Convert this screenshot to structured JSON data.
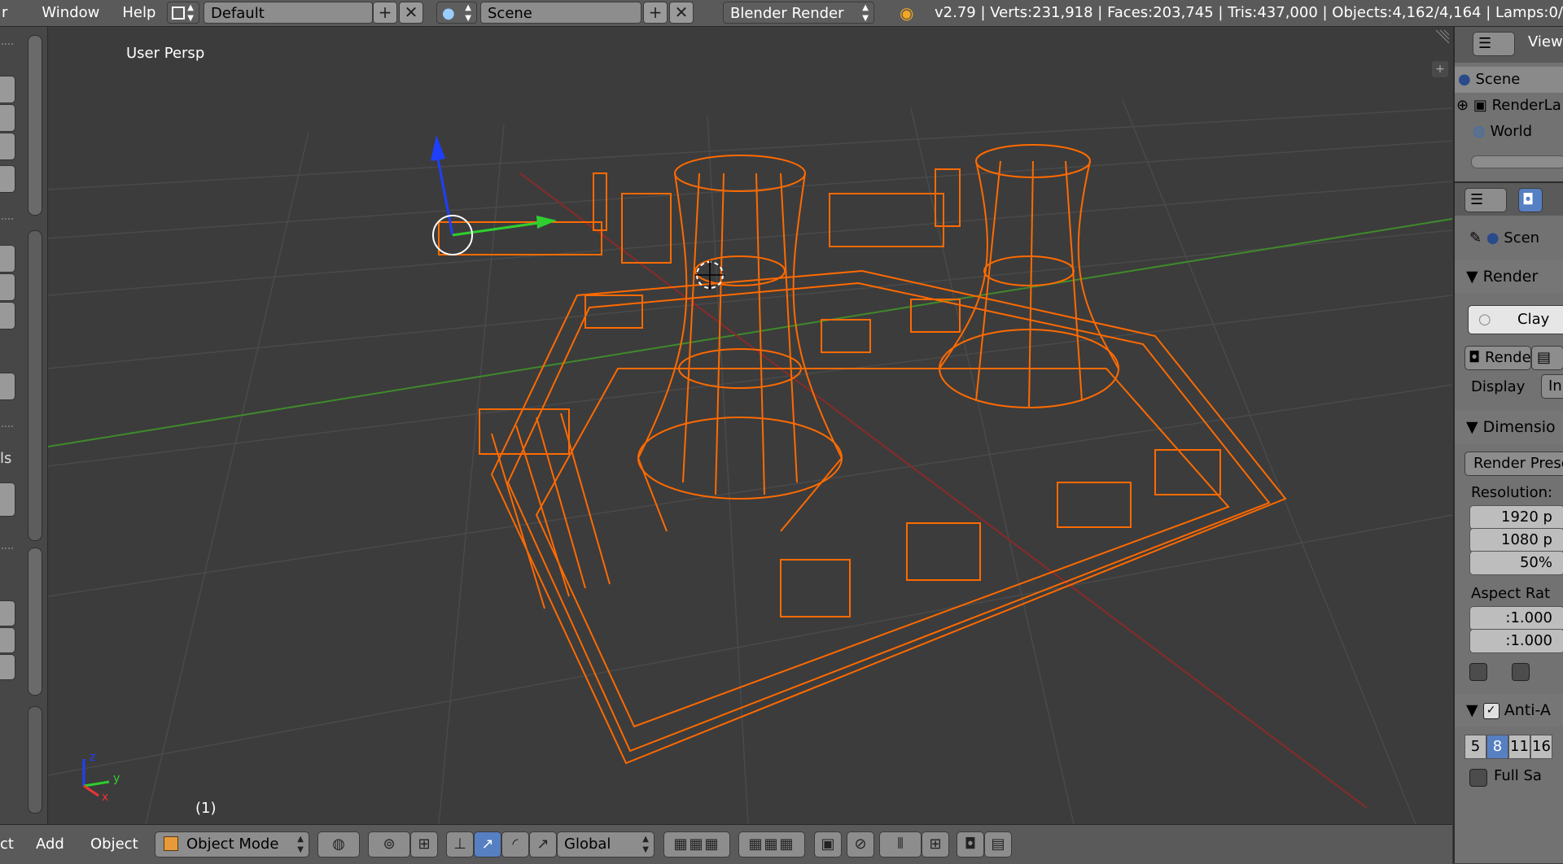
{
  "topbar": {
    "menus": [
      "r",
      "Window",
      "Help"
    ],
    "layout": "Default",
    "scene": "Scene",
    "engine": "Blender Render",
    "stats": "v2.79 | Verts:231,918 | Faces:203,745 | Tris:437,000 | Objects:4,162/4,164 | Lamps:0/1"
  },
  "left_strip": {
    "partial_label": "ls"
  },
  "viewport": {
    "view_label": "User Persp",
    "frame_label": "(1)",
    "axis_labels": {
      "x": "x",
      "y": "y",
      "z": "z"
    },
    "colors": {
      "wire": "#ff6a00",
      "grid": "#4a4a4a",
      "x_axis": "#8a2a2a",
      "y_axis": "#3f8a2b"
    }
  },
  "bottombar": {
    "menus": [
      "ct",
      "Add",
      "Object"
    ],
    "mode": "Object Mode",
    "orientation": "Global"
  },
  "outliner": {
    "header": "View",
    "rows": [
      "Scene",
      "RenderLa",
      "World"
    ]
  },
  "properties": {
    "context": "Scen",
    "render_header": "Render",
    "render_preset_label": "Clay",
    "render_button": "Rende",
    "display_label": "Display",
    "display_value": "In",
    "dimensions_header": "Dimensio",
    "render_presets": "Render Prese",
    "resolution_label": "Resolution:",
    "res_x": "1920 p",
    "res_y": "1080 p",
    "res_pct": "50%",
    "aspect_label": "Aspect Rat",
    "aspect_x": ":1.000",
    "aspect_y": ":1.000",
    "aa_header": "Anti-A",
    "aa_samples": [
      "5",
      "8",
      "11",
      "16"
    ],
    "aa_selected": "8",
    "full_sample": "Full Sa"
  }
}
